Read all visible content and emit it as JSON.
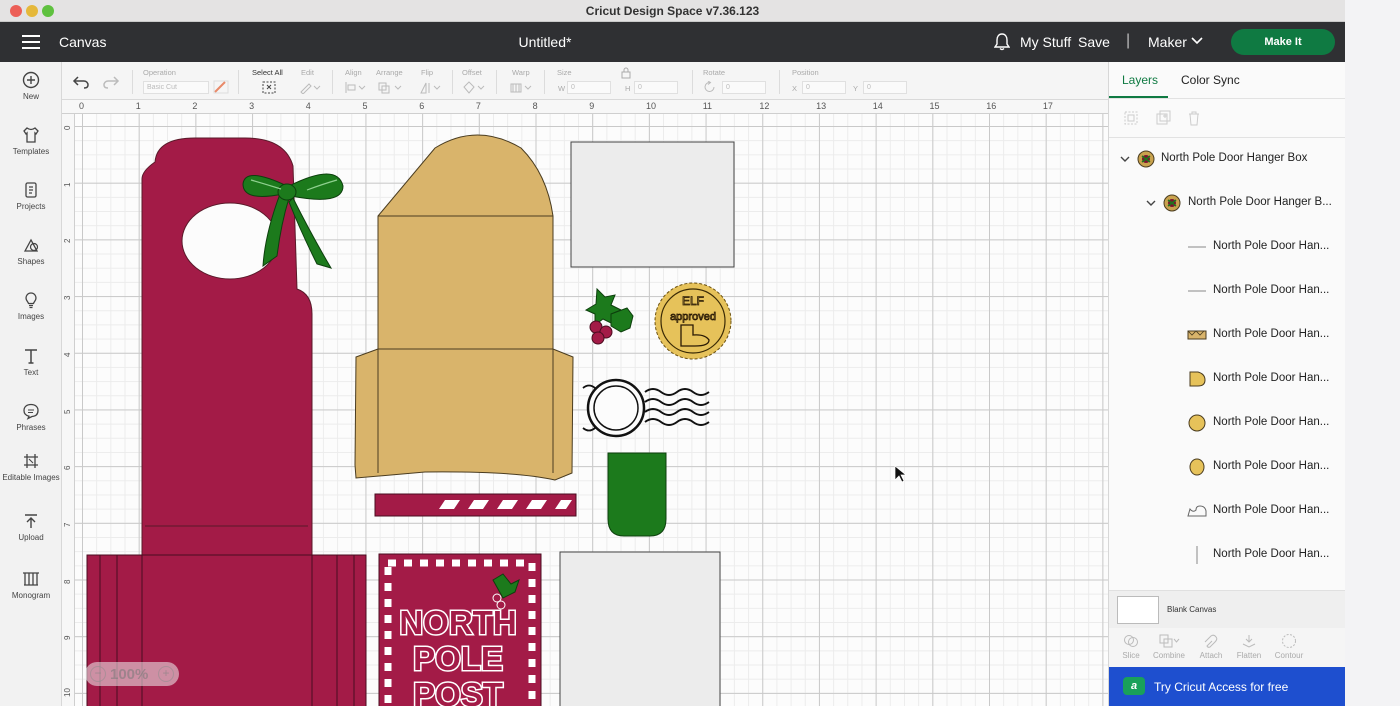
{
  "window": {
    "title": "Cricut Design Space  v7.36.123"
  },
  "header": {
    "canvas_label": "Canvas",
    "doc_title": "Untitled*",
    "my_stuff": "My Stuff",
    "save": "Save",
    "separator": "|",
    "machine": "Maker",
    "make_it": "Make It"
  },
  "sidebar": {
    "items": [
      {
        "label": "New",
        "icon": "plus-circle-icon"
      },
      {
        "label": "Templates",
        "icon": "shirt-icon"
      },
      {
        "label": "Projects",
        "icon": "projects-icon"
      },
      {
        "label": "Shapes",
        "icon": "shapes-icon"
      },
      {
        "label": "Images",
        "icon": "lightbulb-icon"
      },
      {
        "label": "Text",
        "icon": "text-icon"
      },
      {
        "label": "Phrases",
        "icon": "speech-bubble-icon"
      },
      {
        "label": "Editable Images",
        "icon": "editable-images-icon"
      },
      {
        "label": "Upload",
        "icon": "upload-icon"
      },
      {
        "label": "Monogram",
        "icon": "monogram-icon"
      }
    ]
  },
  "toolbar": {
    "operation_label": "Operation",
    "operation_value": "Basic Cut",
    "select_all": "Select All",
    "edit": "Edit",
    "align": "Align",
    "arrange": "Arrange",
    "flip": "Flip",
    "offset": "Offset",
    "warp": "Warp",
    "size": "Size",
    "size_w": "W",
    "size_w_value": "0",
    "size_h": "H",
    "size_h_value": "0",
    "rotate": "Rotate",
    "rotate_value": "0",
    "position": "Position",
    "pos_x": "X",
    "pos_x_value": "0",
    "pos_y": "Y",
    "pos_y_value": "0"
  },
  "rulers": {
    "top": [
      "0",
      "1",
      "2",
      "3",
      "4",
      "5",
      "6",
      "7",
      "8",
      "9",
      "10",
      "11",
      "12",
      "13",
      "14",
      "15",
      "16",
      "17"
    ],
    "left": [
      "0",
      "1",
      "2",
      "3",
      "4",
      "5",
      "6",
      "7",
      "8",
      "9",
      "10"
    ]
  },
  "canvas": {
    "zoom": "100%",
    "art": {
      "stamp_text_top": "ELF",
      "stamp_text_bottom": "approved",
      "card_line1": "NORTH",
      "card_line2": "POLE",
      "card_line3": "POST"
    }
  },
  "colors": {
    "crimson": "#a31b47",
    "tan": "#d9b46b",
    "green": "#1c7a1c",
    "gold": "#e6c25a",
    "accent": "#0f7a42"
  },
  "panel": {
    "tabs": [
      "Layers",
      "Color Sync"
    ],
    "layers": [
      {
        "name": "North Pole Door Hanger Box",
        "icon": "group-ornament-icon"
      },
      {
        "name": "North Pole Door Hanger B...",
        "icon": "group-ornament-icon"
      },
      {
        "name": "North Pole Door Han...",
        "icon": "line-horizontal-icon"
      },
      {
        "name": "North Pole Door Han...",
        "icon": "line-horizontal-icon"
      },
      {
        "name": "North Pole Door Han...",
        "icon": "banner-shape-icon"
      },
      {
        "name": "North Pole Door Han...",
        "icon": "tan-blob-icon"
      },
      {
        "name": "North Pole Door Han...",
        "icon": "tan-circle-icon"
      },
      {
        "name": "North Pole Door Han...",
        "icon": "tan-oval-icon"
      },
      {
        "name": "North Pole Door Han...",
        "icon": "outline-shape-icon"
      },
      {
        "name": "North Pole Door Han...",
        "icon": "line-vertical-icon"
      }
    ],
    "blank_canvas": "Blank Canvas",
    "actions": [
      "Slice",
      "Combine",
      "Attach",
      "Flatten",
      "Contour"
    ],
    "access_banner": "Try Cricut Access for free"
  }
}
